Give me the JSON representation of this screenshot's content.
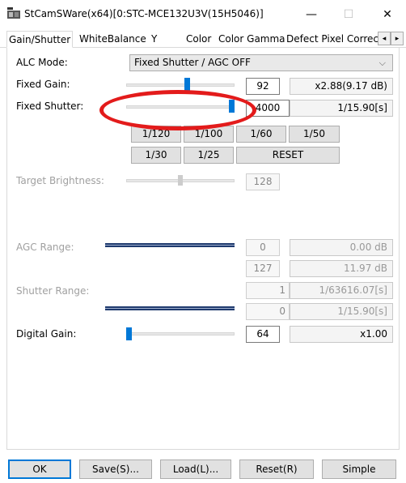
{
  "window": {
    "title": "StCamSWare(x64)[0:STC-MCE132U3V(15H5046)]",
    "min_glyph": "—",
    "max_glyph": "☐",
    "close_glyph": "✕",
    "app_icon": "camera-app-icon"
  },
  "tabs": [
    "Gain/Shutter",
    "WhiteBalance",
    "Y",
    "Color",
    "Color Gamma",
    "Defect Pixel Correc"
  ],
  "tab_scroll": {
    "left": "◂",
    "right": "▸"
  },
  "alc": {
    "label": "ALC Mode:",
    "value": "Fixed Shutter / AGC OFF",
    "chevron": "⌵"
  },
  "fixed_gain": {
    "label": "Fixed Gain:",
    "value": "92",
    "readout": "x2.88(9.17 dB)",
    "level": 0.57
  },
  "fixed_shutter": {
    "label": "Fixed Shutter:",
    "value": "4000",
    "readout": "1/15.90[s]",
    "level": 1.0
  },
  "presets": {
    "row1": [
      "1/120",
      "1/100",
      "1/60",
      "1/50"
    ],
    "row2": [
      "1/30",
      "1/25",
      "RESET"
    ]
  },
  "target_brightness": {
    "label": "Target Brightness:",
    "value": "128",
    "level": 0.5
  },
  "agc_range": {
    "label": "AGC Range:",
    "min_value": "0",
    "min_readout": "0.00 dB",
    "max_value": "127",
    "max_readout": "11.97 dB"
  },
  "shutter_range": {
    "label": "Shutter Range:",
    "min_value": "1",
    "min_readout": "1/63616.07[s]",
    "max_value": "0",
    "max_readout": "1/15.90[s]"
  },
  "digital_gain": {
    "label": "Digital Gain:",
    "value": "64",
    "readout": "x1.00",
    "level": 0.0
  },
  "footer": {
    "ok": "OK",
    "save": "Save(S)...",
    "load": "Load(L)...",
    "reset": "Reset(R)",
    "simple": "Simple"
  },
  "colors": {
    "accent": "#0078d7",
    "annotation": "#e31b1b",
    "range_bar": "#1f3a6e"
  }
}
